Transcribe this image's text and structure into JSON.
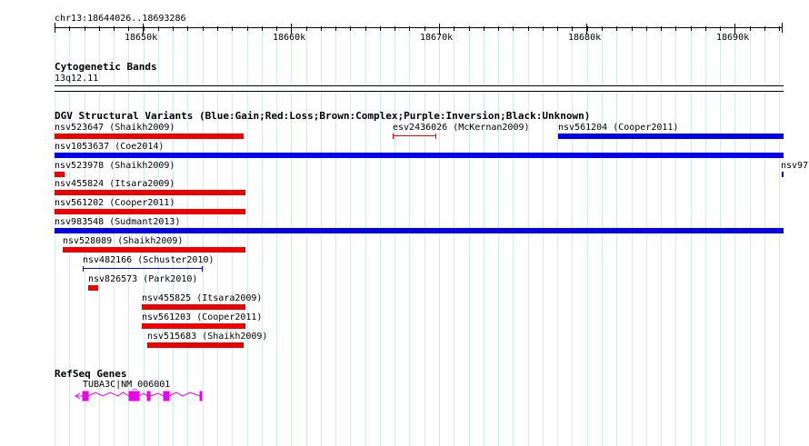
{
  "header": {
    "range_label": "chr13:18644026..18693286",
    "ticks": [
      "18650k",
      "18660k",
      "18670k",
      "18680k",
      "18690k"
    ]
  },
  "cytoband": {
    "title": "Cytogenetic Bands",
    "band_label": "13q12.11"
  },
  "dgv": {
    "title": "DGV Structural Variants (Blue:Gain;Red:Loss;Brown:Complex;Purple:Inversion;Black:Unknown)",
    "colors": {
      "gain": "#0000ee",
      "loss": "#ee0000"
    },
    "variants": [
      {
        "label": "nsv523647 (Shaikh2009)",
        "type": "loss"
      },
      {
        "label": "esv2436026 (McKernan2009)",
        "type": "loss",
        "style": "interval"
      },
      {
        "label": "nsv561204 (Cooper2011)",
        "type": "gain"
      },
      {
        "label": "nsv1053637 (Coe2014)",
        "type": "gain"
      },
      {
        "label": "nsv523978 (Shaikh2009)",
        "type": "loss"
      },
      {
        "label": "nsv97",
        "type": "gain",
        "style": "interval"
      },
      {
        "label": "nsv455824 (Itsara2009)",
        "type": "loss"
      },
      {
        "label": "nsv561202 (Cooper2011)",
        "type": "loss"
      },
      {
        "label": "nsv983548 (Sudmant2013)",
        "type": "gain"
      },
      {
        "label": "nsv528089 (Shaikh2009)",
        "type": "loss"
      },
      {
        "label": "nsv482166 (Schuster2010)",
        "type": "gain",
        "style": "interval"
      },
      {
        "label": "nsv826573 (Park2010)",
        "type": "loss"
      },
      {
        "label": "nsv455825 (Itsara2009)",
        "type": "loss"
      },
      {
        "label": "nsv561203 (Cooper2011)",
        "type": "loss"
      },
      {
        "label": "nsv515683 (Shaikh2009)",
        "type": "loss"
      }
    ]
  },
  "refseq": {
    "title": "RefSeq Genes",
    "gene_label": "TUBA3C|NM_006001",
    "color": "#ee00ee"
  }
}
